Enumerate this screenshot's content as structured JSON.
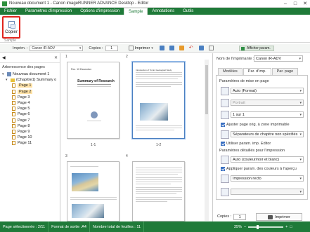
{
  "window": {
    "title": "Nouveau document 1 - Canon imageRUNNER ADVANCE Desktop - Editor"
  },
  "ribbon_tabs": [
    "Fichier",
    "Paramètres d'impression",
    "Options d'impression",
    "Sample",
    "Annotations",
    "Outils"
  ],
  "active_tab_index": 3,
  "ribbon": {
    "copy_label": "Copier",
    "group_label": "Sample"
  },
  "printbar": {
    "printer_label": "Imprim. :",
    "printer_value": "Canon iR-ADV",
    "copies_label": "Copies :",
    "copies_value": "1",
    "print_label": "Imprimer",
    "show_settings_label": "Afficher param."
  },
  "leftpane": {
    "title": "Arborescence des pages",
    "tree": [
      {
        "label": "Nouveau document 1",
        "level": 0,
        "type": "doc"
      },
      {
        "label": "(Chapitre1) Summary o",
        "level": 1,
        "type": "chapter"
      },
      {
        "label": "Page 1",
        "level": 2,
        "type": "page",
        "selected": true
      },
      {
        "label": "Page 2",
        "level": 2,
        "type": "page",
        "selected": true
      },
      {
        "label": "Page 3",
        "level": 2,
        "type": "page"
      },
      {
        "label": "Page 4",
        "level": 2,
        "type": "page"
      },
      {
        "label": "Page 5",
        "level": 2,
        "type": "page"
      },
      {
        "label": "Page 6",
        "level": 2,
        "type": "page"
      },
      {
        "label": "Page 7",
        "level": 2,
        "type": "page"
      },
      {
        "label": "Page 8",
        "level": 2,
        "type": "page"
      },
      {
        "label": "Page 9",
        "level": 2,
        "type": "page"
      },
      {
        "label": "Page 10",
        "level": 2,
        "type": "page"
      },
      {
        "label": "Page 11",
        "level": 2,
        "type": "page"
      }
    ]
  },
  "preview": {
    "pages": [
      {
        "num": "1",
        "label": "1-1",
        "title": "Summary of Research",
        "header": "Pen. 10 December",
        "selected": false
      },
      {
        "num": "2",
        "label": "1-2",
        "header": "Introduction of Tomin Geological Study",
        "selected": true
      },
      {
        "num": "3"
      },
      {
        "num": "4"
      }
    ]
  },
  "rightpane": {
    "printer_name_label": "Nom de l'imprimante :",
    "printer_name_value": "Canon iR-ADV",
    "tabs": [
      "Modèles",
      "Par. d'imp.",
      "Par. page"
    ],
    "active_tab_index": 1,
    "layout_section": "Paramètres de mise en page",
    "format_value": "Auto (Format)",
    "orientation_value": "Portrait",
    "nup_value": "1 sur 1",
    "adjust_check": "Ajuster page orig. à zone imprimable",
    "separator_value": "Séparateurs de chapitre non spécifiés",
    "use_params_check": "Utiliser param. imp. Editor",
    "detailed_section": "Paramètres détaillés pour l'impression",
    "color_value": "Auto (couleur/noir et blanc)",
    "apply_check": "Appliquer param. des couleurs à l'aperçu",
    "duplex_value": "Impression recto",
    "copies_label": "Copies :",
    "copies_value": "1",
    "print_button": "Imprimer"
  },
  "statusbar": {
    "selected": "Page sélectionnée : 2/11",
    "format": "Format de sortie :A4",
    "total": "Nombre total de feuilles : 11",
    "zoom": "25%"
  }
}
